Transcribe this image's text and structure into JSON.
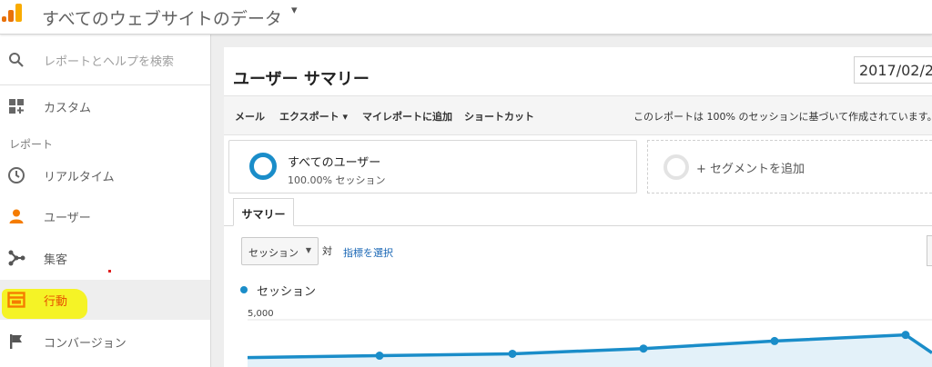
{
  "header": {
    "property_title": "すべてのウェブサイトのデータ",
    "property_caret": "▾"
  },
  "colors": {
    "accent": "#1a8dc9",
    "user_icon": "#f57c00",
    "highlight": "#f4f21a",
    "link": "#1a67b5"
  },
  "sidebar": {
    "search_placeholder": "レポートとヘルプを検索",
    "custom_label": "カスタム",
    "section_label": "レポート",
    "items": [
      {
        "label": "リアルタイム",
        "icon": "clock-icon"
      },
      {
        "label": "ユーザー",
        "icon": "person-icon"
      },
      {
        "label": "集客",
        "icon": "acquisition-icon"
      },
      {
        "label": "行動",
        "icon": "behavior-icon"
      },
      {
        "label": "コンバージョン",
        "icon": "flag-icon"
      }
    ]
  },
  "report": {
    "title": "ユーザー サマリー",
    "date_range": "2017/02/2"
  },
  "toolbar": {
    "email": "メール",
    "export": "エクスポート ▾",
    "add_to_dashboard": "マイレポートに追加",
    "shortcut": "ショートカット",
    "note": "このレポートは 100% のセッションに基づいて作成されています。"
  },
  "segments": {
    "current_name": "すべてのユーザー",
    "current_sub": "100.00% セッション",
    "add_label": "+ セグメントを追加"
  },
  "tabs": {
    "summary": "サマリー"
  },
  "metric_controls": {
    "selected_metric": "セッション",
    "vs_label": "対",
    "select_metric_link": "指標を選択"
  },
  "chart_data": {
    "type": "line",
    "series": [
      {
        "name": "セッション",
        "values": [
          3400,
          3480,
          3560,
          3780,
          4100,
          4360,
          3600
        ]
      }
    ],
    "y_tick_label": "5,000",
    "ylim": [
      3000,
      5000
    ]
  }
}
